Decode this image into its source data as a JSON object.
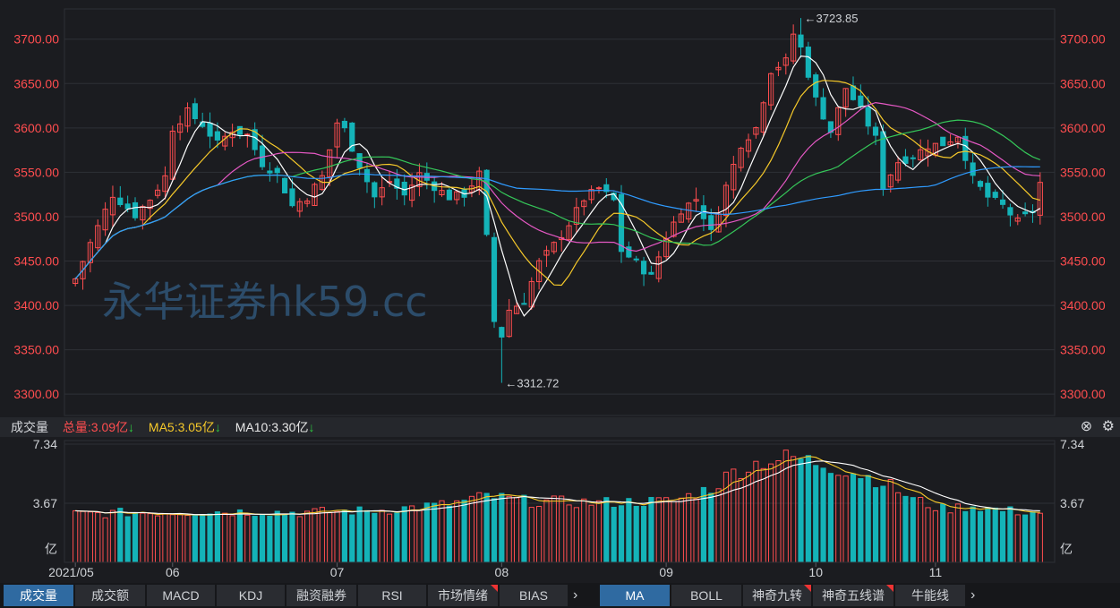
{
  "chart_data": {
    "type": "candlestick",
    "price_axis": {
      "ylim": [
        3280,
        3730
      ],
      "ticks": [
        3300,
        3350,
        3400,
        3450,
        3500,
        3550,
        3600,
        3650,
        3700
      ],
      "tick_labels": [
        "3300.00",
        "3350.00",
        "3400.00",
        "3450.00",
        "3500.00",
        "3550.00",
        "3600.00",
        "3650.00",
        "3700.00"
      ]
    },
    "annotations": {
      "high_label": "←3723.85",
      "low_label": "←3312.72",
      "high": 3723.85,
      "low": 3312.72
    },
    "watermark": "永华证券hk59.cc",
    "volume_axis": {
      "ylim": [
        0,
        7.34
      ],
      "tick_labels": [
        "7.34",
        "3.67",
        "亿"
      ]
    },
    "x_labels": [
      "2021/05",
      "06",
      "07",
      "08",
      "09",
      "10",
      "11"
    ],
    "x_label_positions": [
      0,
      13,
      35,
      57,
      79,
      99,
      115
    ],
    "ohlc_anchors": [
      [
        0,
        3430
      ],
      [
        2,
        3470
      ],
      [
        5,
        3525
      ],
      [
        8,
        3502
      ],
      [
        10,
        3520
      ],
      [
        12,
        3545
      ],
      [
        13,
        3600
      ],
      [
        15,
        3618
      ],
      [
        17,
        3604
      ],
      [
        19,
        3582
      ],
      [
        21,
        3598
      ],
      [
        23,
        3592
      ],
      [
        25,
        3560
      ],
      [
        27,
        3548
      ],
      [
        29,
        3512
      ],
      [
        31,
        3522
      ],
      [
        33,
        3545
      ],
      [
        35,
        3606
      ],
      [
        36,
        3598
      ],
      [
        38,
        3558
      ],
      [
        40,
        3522
      ],
      [
        42,
        3540
      ],
      [
        44,
        3524
      ],
      [
        46,
        3548
      ],
      [
        48,
        3534
      ],
      [
        50,
        3522
      ],
      [
        52,
        3525
      ],
      [
        54,
        3548
      ],
      [
        55,
        3476
      ],
      [
        56,
        3382
      ],
      [
        57,
        3366
      ],
      [
        58,
        3395
      ],
      [
        60,
        3405
      ],
      [
        62,
        3448
      ],
      [
        64,
        3468
      ],
      [
        66,
        3492
      ],
      [
        68,
        3520
      ],
      [
        70,
        3532
      ],
      [
        72,
        3518
      ],
      [
        73,
        3462
      ],
      [
        75,
        3448
      ],
      [
        77,
        3432
      ],
      [
        79,
        3478
      ],
      [
        81,
        3508
      ],
      [
        83,
        3520
      ],
      [
        85,
        3482
      ],
      [
        87,
        3534
      ],
      [
        89,
        3582
      ],
      [
        91,
        3600
      ],
      [
        93,
        3665
      ],
      [
        95,
        3675
      ],
      [
        96,
        3706
      ],
      [
        97,
        3690
      ],
      [
        99,
        3632
      ],
      [
        101,
        3596
      ],
      [
        103,
        3645
      ],
      [
        105,
        3620
      ],
      [
        107,
        3588
      ],
      [
        108,
        3535
      ],
      [
        110,
        3562
      ],
      [
        112,
        3568
      ],
      [
        114,
        3580
      ],
      [
        116,
        3582
      ],
      [
        118,
        3592
      ],
      [
        119,
        3568
      ],
      [
        120,
        3542
      ],
      [
        122,
        3522
      ],
      [
        124,
        3512
      ],
      [
        126,
        3494
      ],
      [
        128,
        3506
      ],
      [
        129,
        3538
      ]
    ],
    "ma_curves": [
      {
        "name": "MA5",
        "color": "#ffffff",
        "period": 5
      },
      {
        "name": "MA10",
        "color": "#f6c92a",
        "period": 10
      },
      {
        "name": "MA20",
        "color": "#e558c4",
        "period": 20
      },
      {
        "name": "MA30",
        "color": "#35c759",
        "period": 30
      },
      {
        "name": "MA60",
        "color": "#2f9bff",
        "period": 60
      }
    ],
    "volume_anchors": [
      [
        0,
        3.0
      ],
      [
        10,
        3.1
      ],
      [
        20,
        3.15
      ],
      [
        30,
        3.1
      ],
      [
        40,
        3.2
      ],
      [
        50,
        3.6
      ],
      [
        55,
        4.1
      ],
      [
        60,
        3.8
      ],
      [
        70,
        3.7
      ],
      [
        80,
        3.8
      ],
      [
        85,
        4.6
      ],
      [
        88,
        5.6
      ],
      [
        92,
        6.3
      ],
      [
        96,
        6.5
      ],
      [
        100,
        6.1
      ],
      [
        104,
        5.6
      ],
      [
        108,
        5.0
      ],
      [
        112,
        3.9
      ],
      [
        116,
        3.3
      ],
      [
        120,
        3.5
      ],
      [
        124,
        3.2
      ],
      [
        129,
        3.1
      ]
    ],
    "candle_count": 130
  },
  "indicator_bar": {
    "title": "成交量",
    "total": "总量:3.09亿",
    "ma5": "MA5:3.05亿",
    "ma10": "MA10:3.30亿",
    "down_arrow": "↓",
    "close_icon": "⊗",
    "gear_icon": "⚙"
  },
  "tabs_left": [
    "成交量",
    "成交额",
    "MACD",
    "KDJ",
    "融资融券",
    "RSI",
    "市场情绪",
    "BIAS"
  ],
  "tabs_right": [
    "MA",
    "BOLL",
    "神奇九转",
    "神奇五线谱",
    "牛能线"
  ],
  "nav_arrow": "›",
  "colors": {
    "up": "#ff4d4f",
    "down": "#14b3b8",
    "background": "#1b1c20",
    "grid": "#2e3036",
    "axis_text_price": "#ff4d4f",
    "axis_text": "#cfd2d6"
  }
}
